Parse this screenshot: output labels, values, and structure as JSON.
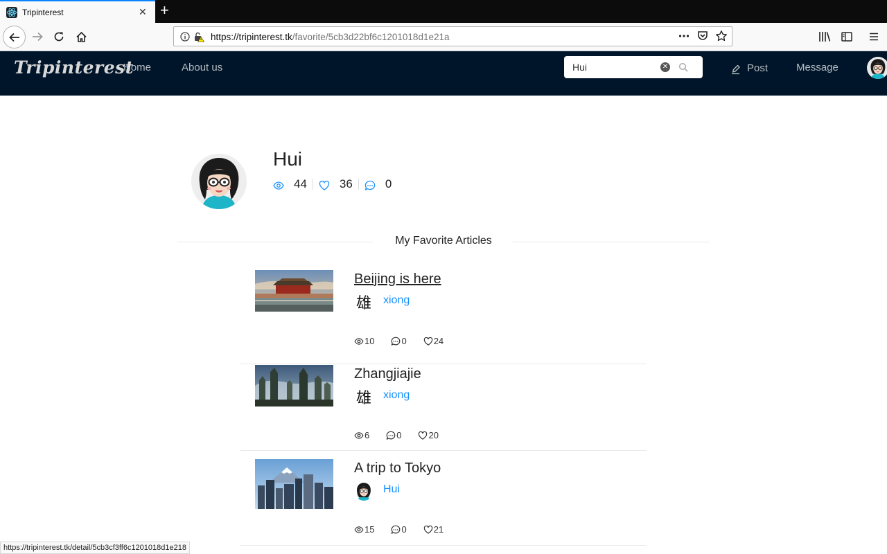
{
  "browser": {
    "tab_title": "Tripinterest",
    "url_host": "https://tripinterest.tk",
    "url_path": "/favorite/5cb3d22bf6c1201018d1e21a",
    "status_url": "https://tripinterest.tk/detail/5cb3cf3ff6c1201018d1e218"
  },
  "header": {
    "logo": "Tripinterest",
    "nav": {
      "home": "Home",
      "about": "About us"
    },
    "search": {
      "value": "Hui"
    },
    "post": "Post",
    "message": "Message"
  },
  "profile": {
    "name": "Hui",
    "views": "44",
    "likes": "36",
    "comments": "0"
  },
  "section_title": "My Favorite Articles",
  "articles": [
    {
      "title": "Beijing is here",
      "author": "xiong",
      "author_avatar_char": "雄",
      "views": "10",
      "comments": "0",
      "likes": "24"
    },
    {
      "title": "Zhangjiajie",
      "author": "xiong",
      "author_avatar_char": "雄",
      "views": "6",
      "comments": "0",
      "likes": "20"
    },
    {
      "title": "A trip to Tokyo",
      "author": "Hui",
      "views": "15",
      "comments": "0",
      "likes": "21"
    }
  ]
}
